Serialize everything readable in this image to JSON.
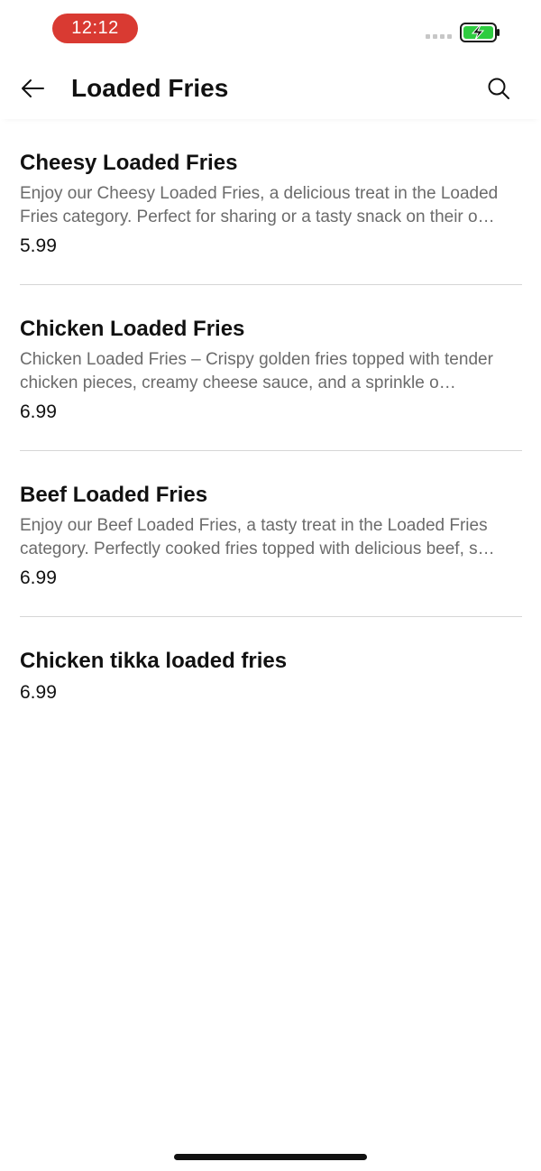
{
  "status_bar": {
    "time": "12:12"
  },
  "header": {
    "title": "Loaded Fries",
    "back_icon": "arrow-left-icon",
    "search_icon": "search-icon"
  },
  "menu": {
    "items": [
      {
        "name": "Cheesy Loaded Fries",
        "description": "Enjoy our Cheesy Loaded Fries, a delicious treat in the Loaded Fries category. Perfect for sharing or a tasty snack on their o…",
        "price": "5.99"
      },
      {
        "name": "Chicken Loaded Fries",
        "description": "Chicken Loaded Fries – Crispy golden fries topped with tender chicken pieces, creamy cheese sauce, and a sprinkle o…",
        "price": "6.99"
      },
      {
        "name": "Beef Loaded Fries",
        "description": "Enjoy our Beef Loaded Fries, a tasty treat in the Loaded Fries category. Perfectly cooked fries topped with delicious beef, s…",
        "price": "6.99"
      },
      {
        "name": "Chicken tikka loaded fries",
        "description": "",
        "price": "6.99"
      }
    ]
  },
  "colors": {
    "time_pill": "#d93a32",
    "battery": "#2ecc40",
    "divider": "#d6d6d6",
    "description_text": "#6b6b6b"
  }
}
